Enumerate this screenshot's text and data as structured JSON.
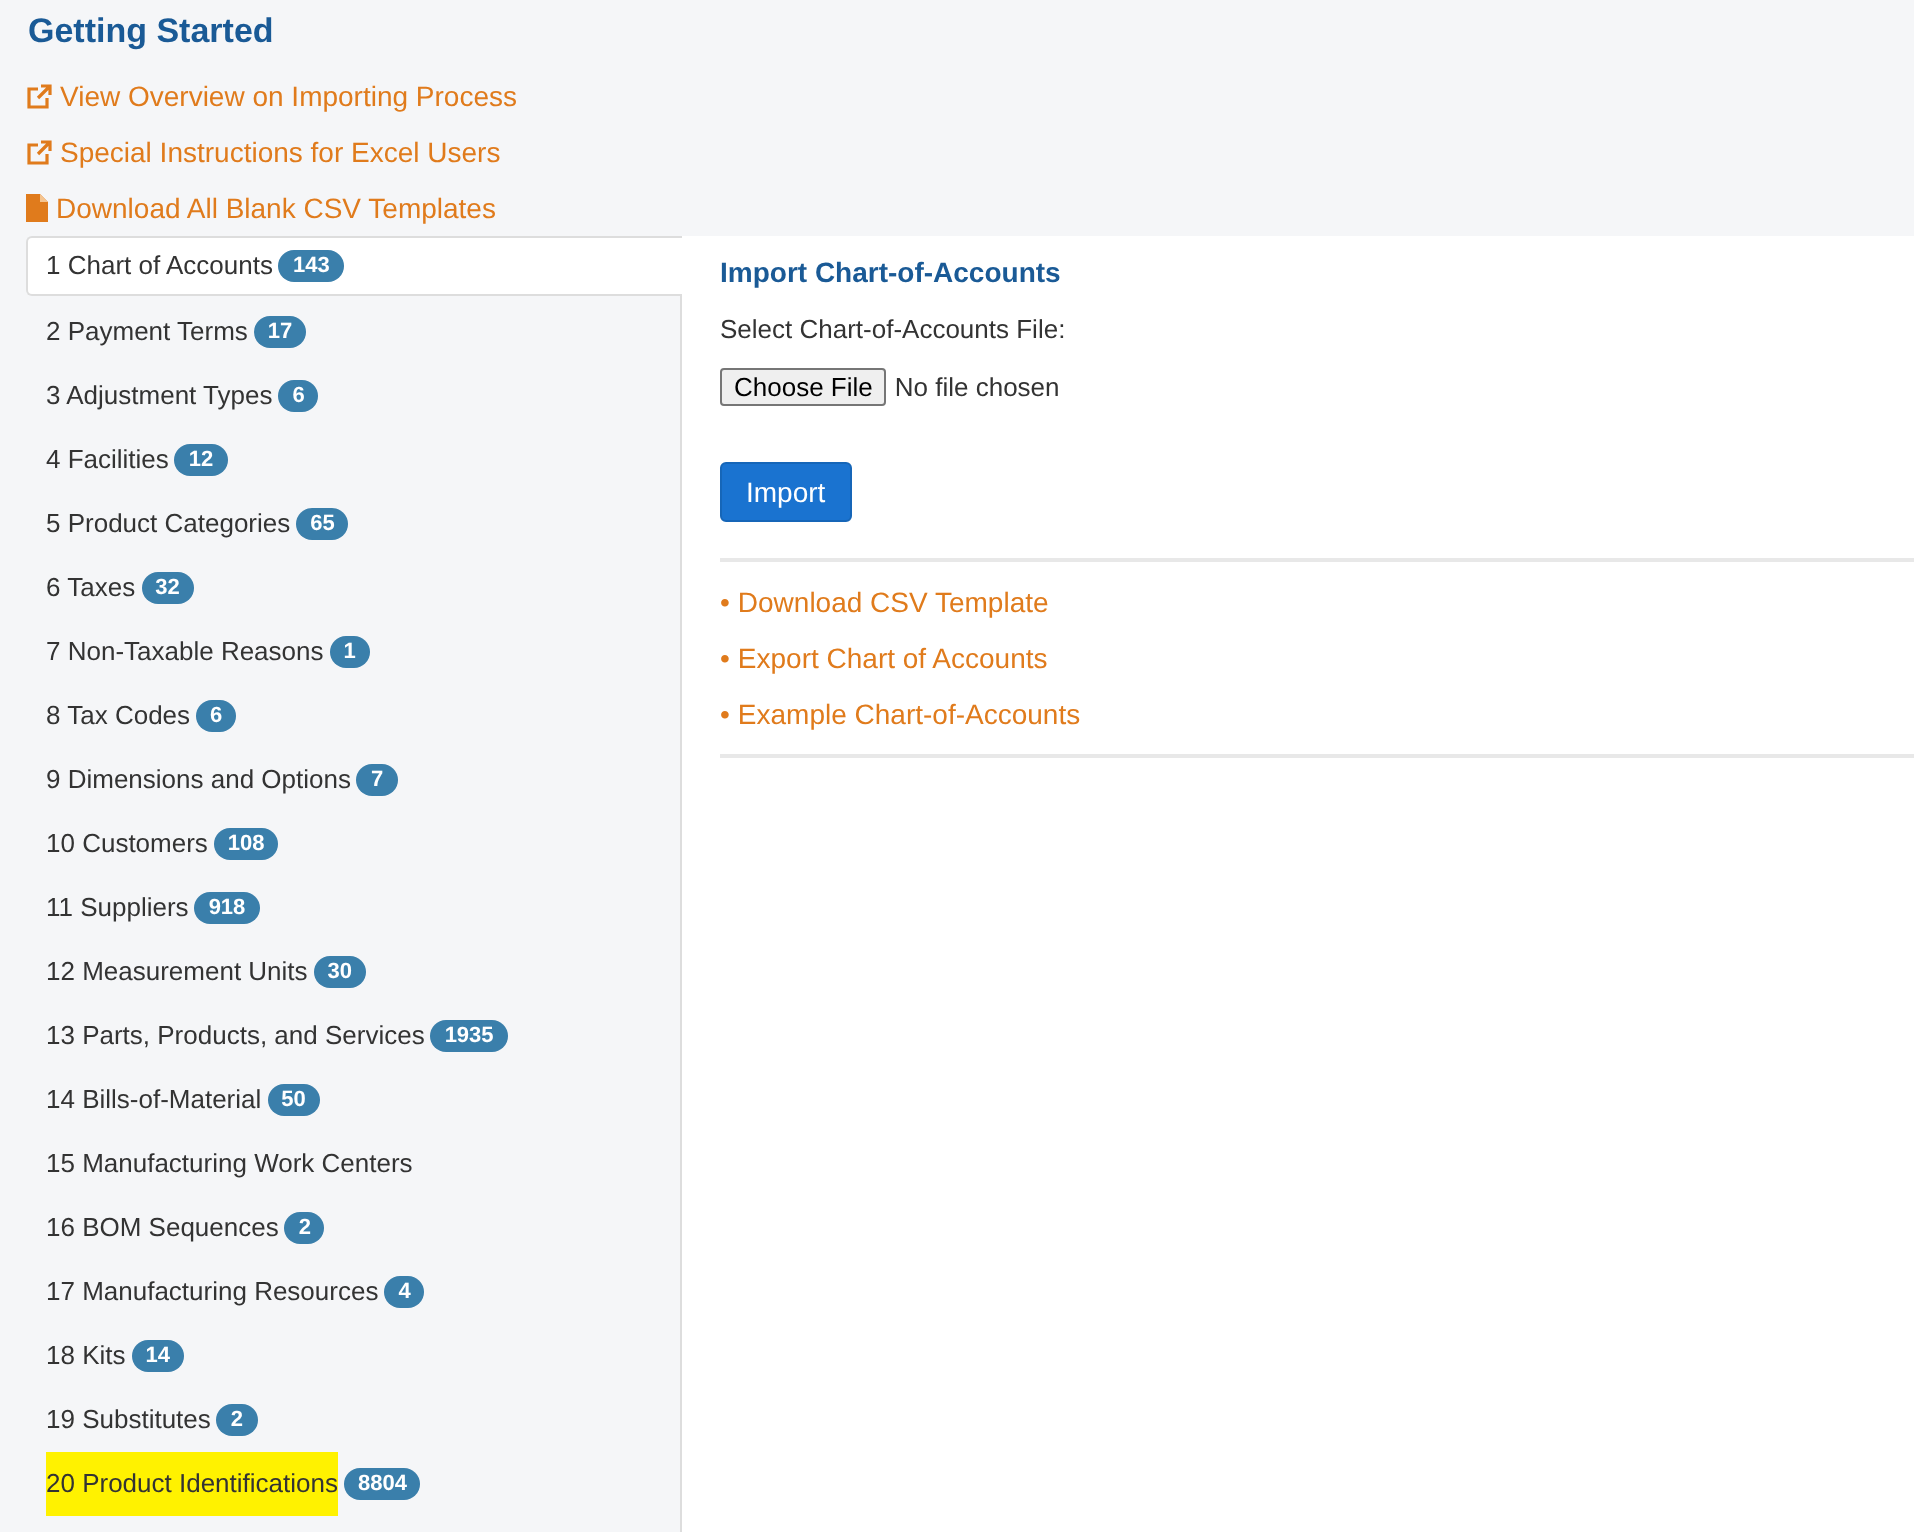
{
  "title": "Getting Started",
  "links": [
    {
      "kind": "external",
      "label": "View Overview on Importing Process"
    },
    {
      "kind": "external",
      "label": "Special Instructions for Excel Users"
    },
    {
      "kind": "file",
      "label": "Download All Blank CSV Templates"
    }
  ],
  "steps": [
    {
      "label": "1 Chart of Accounts",
      "count": "143",
      "selected": true,
      "highlighted": false
    },
    {
      "label": "2 Payment Terms",
      "count": "17",
      "selected": false,
      "highlighted": false
    },
    {
      "label": "3 Adjustment Types",
      "count": "6",
      "selected": false,
      "highlighted": false
    },
    {
      "label": "4 Facilities",
      "count": "12",
      "selected": false,
      "highlighted": false
    },
    {
      "label": "5 Product Categories",
      "count": "65",
      "selected": false,
      "highlighted": false
    },
    {
      "label": "6 Taxes",
      "count": "32",
      "selected": false,
      "highlighted": false
    },
    {
      "label": "7 Non-Taxable Reasons",
      "count": "1",
      "selected": false,
      "highlighted": false
    },
    {
      "label": "8 Tax Codes",
      "count": "6",
      "selected": false,
      "highlighted": false
    },
    {
      "label": "9 Dimensions and Options",
      "count": "7",
      "selected": false,
      "highlighted": false
    },
    {
      "label": "10 Customers",
      "count": "108",
      "selected": false,
      "highlighted": false
    },
    {
      "label": "11 Suppliers",
      "count": "918",
      "selected": false,
      "highlighted": false
    },
    {
      "label": "12 Measurement Units",
      "count": "30",
      "selected": false,
      "highlighted": false
    },
    {
      "label": "13 Parts, Products, and Services",
      "count": "1935",
      "selected": false,
      "highlighted": false
    },
    {
      "label": "14 Bills-of-Material",
      "count": "50",
      "selected": false,
      "highlighted": false
    },
    {
      "label": "15 Manufacturing Work Centers",
      "selected": false,
      "highlighted": false
    },
    {
      "label": "16 BOM Sequences",
      "count": "2",
      "selected": false,
      "highlighted": false
    },
    {
      "label": "17 Manufacturing Resources",
      "count": "4",
      "selected": false,
      "highlighted": false
    },
    {
      "label": "18 Kits",
      "count": "14",
      "selected": false,
      "highlighted": false
    },
    {
      "label": "19 Substitutes",
      "count": "2",
      "selected": false,
      "highlighted": false
    },
    {
      "label": "20 Product Identifications",
      "count": "8804",
      "selected": false,
      "highlighted": true
    }
  ],
  "panel": {
    "title": "Import Chart-of-Accounts",
    "file_label": "Select Chart-of-Accounts File:",
    "file_button": "Choose File",
    "file_status": "No file chosen",
    "import_button": "Import",
    "links": [
      {
        "bullet": "•",
        "label": "Download CSV Template"
      },
      {
        "bullet": "•",
        "label": "Export Chart of Accounts"
      },
      {
        "bullet": "•",
        "label": "Example Chart-of-Accounts"
      }
    ]
  }
}
